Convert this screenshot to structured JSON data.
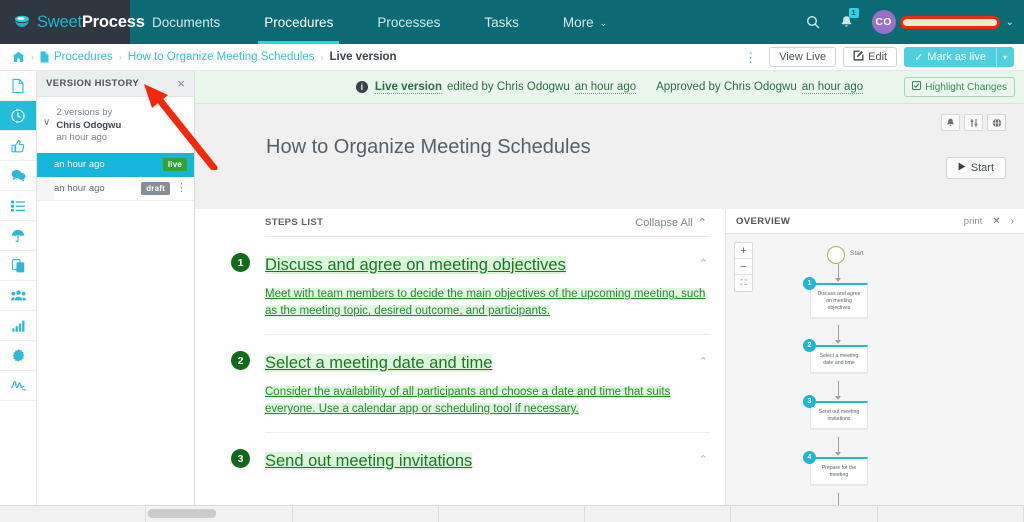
{
  "brand": {
    "name_part1": "Sweet",
    "name_part2": "Process",
    "logo_icon": "cup-icon"
  },
  "topnav": {
    "items": [
      {
        "label": "Documents",
        "active": false
      },
      {
        "label": "Procedures",
        "active": true
      },
      {
        "label": "Processes",
        "active": false
      },
      {
        "label": "Tasks",
        "active": false
      },
      {
        "label": "More",
        "active": false,
        "caret": "⌄"
      }
    ],
    "search_icon": "search-icon",
    "bell_icon": "bell-icon",
    "bell_count": "1",
    "avatar_initials": "CO",
    "user_caret": "⌄"
  },
  "breadcrumb": {
    "home_icon": "home-icon",
    "doc_icon": "document-icon",
    "sep": "›",
    "items": [
      {
        "label": "Procedures",
        "last": false
      },
      {
        "label": "How to Organize Meeting Schedules",
        "last": false
      },
      {
        "label": "Live version",
        "last": true
      }
    ],
    "kebab": "⋮",
    "view_live": "View Live",
    "edit": "Edit",
    "edit_icon": "pencil-icon",
    "mark_as_live": "Mark as live",
    "mark_check": "✓",
    "mark_caret": "▾"
  },
  "rail": {
    "items": [
      {
        "name": "document-icon",
        "glyph": "",
        "active": false
      },
      {
        "name": "clock-history-icon",
        "glyph": "◴",
        "active": true
      },
      {
        "name": "thumbs-up-icon",
        "glyph": "👍",
        "active": false
      },
      {
        "name": "comments-icon",
        "glyph": "💬",
        "active": false
      },
      {
        "name": "checklist-icon",
        "glyph": "☰",
        "active": false
      },
      {
        "name": "umbrella-icon",
        "glyph": "☂",
        "active": false
      },
      {
        "name": "copy-icon",
        "glyph": "⧉",
        "active": false
      },
      {
        "name": "users-icon",
        "glyph": "👥",
        "active": false
      },
      {
        "name": "bar-chart-icon",
        "glyph": "📊",
        "active": false
      },
      {
        "name": "gear-icon",
        "glyph": "⚙",
        "active": false
      },
      {
        "name": "signature-icon",
        "glyph": "∿",
        "active": false
      }
    ]
  },
  "version_history": {
    "title": "VERSION HISTORY",
    "close": "×",
    "group_chevron": "∨",
    "group_count_line": "2 versions by",
    "group_author": "Chris Odogwu",
    "group_time": "an hour ago",
    "rows": [
      {
        "time": "an hour ago",
        "badge": "live",
        "selected": true,
        "kebab": ""
      },
      {
        "time": "an hour ago",
        "badge": "draft",
        "selected": false,
        "kebab": "⋮"
      }
    ]
  },
  "notice": {
    "info_icon": "info-icon",
    "bold_prefix": "Live version",
    "edited_by": " edited by Chris Odogwu ",
    "edited_time": "an hour ago",
    "approved_by": "Approved by Chris Odogwu ",
    "approved_time": "an hour ago",
    "highlight_label": "Highlight Changes",
    "highlight_icon": "checkbox-checked-icon"
  },
  "document": {
    "title": "How to Organize Meeting Schedules",
    "tools": [
      {
        "name": "bell-icon",
        "glyph": "🔔"
      },
      {
        "name": "sliders-icon",
        "glyph": "⇅"
      },
      {
        "name": "globe-icon",
        "glyph": "⊕"
      }
    ],
    "start_label": "Start",
    "start_icon": "play-icon"
  },
  "steps_pane": {
    "header": "STEPS LIST",
    "collapse_all": "Collapse All",
    "collapse_caret": "⌃",
    "steps": [
      {
        "num": "1",
        "title": "Discuss and agree on meeting objectives",
        "body": "Meet with team members to decide the main objectives of the upcoming meeting, such as the meeting topic, desired outcome, and participants.",
        "chevron": "⌃"
      },
      {
        "num": "2",
        "title": "Select a meeting date and time",
        "body": "Consider the availability of all participants and choose a date and time that suits everyone. Use a calendar app or scheduling tool if necessary.",
        "chevron": "⌃"
      },
      {
        "num": "3",
        "title": "Send out meeting invitations",
        "body": "",
        "chevron": "⌃"
      }
    ]
  },
  "overview": {
    "title": "OVERVIEW",
    "print": "print",
    "expand_icon": "expand-icon",
    "expand_glyph": "✕",
    "chevron_icon": "chevron-right-icon",
    "chevron_glyph": "›",
    "zoom_in": "+",
    "zoom_out": "−",
    "zoom_fit": "⛶",
    "start_label": "Start",
    "nodes": [
      {
        "num": "1",
        "label": "Discuss and agree on meeting objectives"
      },
      {
        "num": "2",
        "label": "Select a meeting date and time"
      },
      {
        "num": "3",
        "label": "Send out meeting invitations"
      },
      {
        "num": "4",
        "label": "Prepare for the meeting"
      }
    ]
  },
  "annotation": {
    "type": "red-arrow",
    "color": "#f5280a"
  },
  "colors": {
    "nav_bg": "#0b6a73",
    "logo_bg": "#2f3741",
    "accent_cyan": "#1fb6d4",
    "selected_row": "#16b6da",
    "live_badge": "#33a23a",
    "draft_badge": "#868f95",
    "notice_bg": "#e8f6ec",
    "diff_green_text": "#187a20",
    "diff_green_bg": "#ddf5dd",
    "avatar_bg": "#9a6fc9",
    "annotation_red": "#f5280a"
  }
}
